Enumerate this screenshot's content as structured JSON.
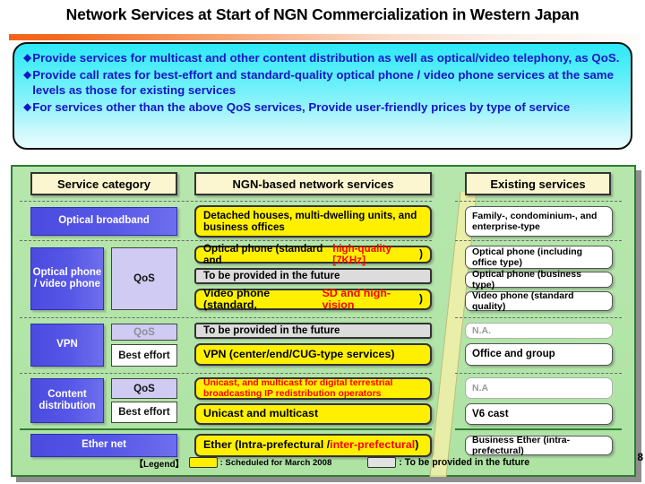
{
  "slide": {
    "title": "Network Services at Start of NGN Commercialization in Western Japan",
    "page_number": "8"
  },
  "callout": {
    "bullet_marker": "◆",
    "bullets": [
      "Provide services for multicast and other content distribution as well as optical/video telephony, as QoS.",
      "Provide call rates for best-effort and standard-quality optical phone / video phone services at the same levels as those for existing services",
      "For services other than the above QoS services, Provide user-friendly prices by type of service"
    ]
  },
  "table": {
    "headers": {
      "category": "Service category",
      "ngn": "NGN-based network services",
      "existing": "Existing services"
    },
    "rows": [
      {
        "category": "Optical broadband",
        "qos_labels": [],
        "ngn": [
          {
            "text": "Detached houses, multi-dwelling units, and business offices",
            "style": "yellow"
          }
        ],
        "existing": [
          {
            "text": "Family-, condominium-, and enterprise-type",
            "style": "normal"
          }
        ]
      },
      {
        "category": "Optical phone / video phone",
        "qos_labels": [
          {
            "text": "QoS",
            "style": "filled"
          }
        ],
        "ngn": [
          {
            "text": "Optical phone (standard and ",
            "red": "high-quality [7KHz]",
            "tail": ")",
            "style": "yellow"
          },
          {
            "text": "To be provided in the future",
            "style": "grey"
          },
          {
            "text": "Video phone (standard, ",
            "red": "SD and high-vision",
            "tail": ")",
            "style": "yellow"
          }
        ],
        "existing": [
          {
            "text": "Optical phone (including office type)",
            "style": "normal"
          },
          {
            "text": "Optical phone (business type)",
            "style": "normal"
          },
          {
            "text": "Video phone (standard quality)",
            "style": "normal"
          }
        ]
      },
      {
        "category": "VPN",
        "qos_labels": [
          {
            "text": "QoS",
            "style": "filled-muted"
          },
          {
            "text": "Best effort",
            "style": "plain"
          }
        ],
        "ngn": [
          {
            "text": "To be provided in the future",
            "style": "grey"
          },
          {
            "text": "VPN (center/end/CUG-type services)",
            "style": "yellow"
          }
        ],
        "existing": [
          {
            "text": "N.A.",
            "style": "na"
          },
          {
            "text": "Office and group",
            "style": "normal"
          }
        ]
      },
      {
        "category": "Content distribution",
        "qos_labels": [
          {
            "text": "QoS",
            "style": "filled"
          },
          {
            "text": "Best effort",
            "style": "plain"
          }
        ],
        "ngn": [
          {
            "text": "Unicast, and multicast for digital terrestrial broadcasting IP redistribution operators",
            "style": "yellow-red-small"
          },
          {
            "text": "Unicast and multicast",
            "style": "yellow"
          }
        ],
        "existing": [
          {
            "text": "N.A",
            "style": "na"
          },
          {
            "text": "V6 cast",
            "style": "normal"
          }
        ]
      },
      {
        "category": "Ether net",
        "qos_labels": [],
        "ngn": [
          {
            "text": "Ether (Intra-prefectural / ",
            "red": "inter-prefectural",
            "tail": ")",
            "style": "yellow"
          }
        ],
        "existing": [
          {
            "text": "Business Ether (intra-prefectural)",
            "style": "normal"
          }
        ]
      }
    ]
  },
  "legend": {
    "label": "【Legend】",
    "yellow_text": ": Scheduled for March 2008",
    "grey_text": ": To be provided in the future"
  },
  "colors": {
    "accent_orange": "#F4631B",
    "callout_cyan": "#2EE8F7",
    "panel_green": "#B6E6AC",
    "category_blue": "#5555E6",
    "service_yellow": "#FFF000",
    "highlight_red": "#FF0000",
    "header_cream": "#FBF6CF"
  }
}
